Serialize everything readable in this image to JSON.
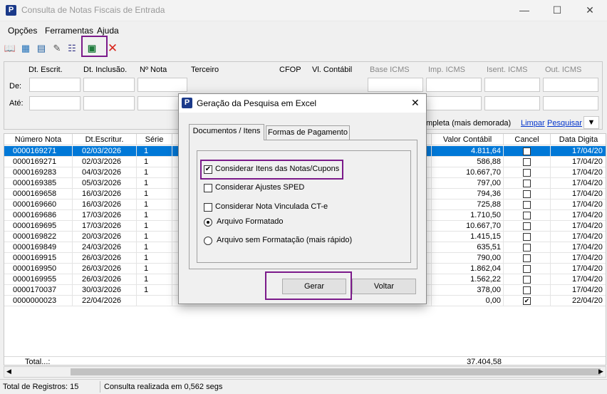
{
  "window": {
    "title": "Consulta de Notas Fiscais de Entrada",
    "logo": "P"
  },
  "menu": [
    "Opções",
    "Ferramentas",
    "Ajuda"
  ],
  "filter": {
    "headers": [
      "Dt. Escrit.",
      "Dt. Inclusão.",
      "Nº Nota",
      "Terceiro",
      "CFOP",
      "Vl. Contábil",
      "Base ICMS",
      "Imp. ICMS",
      "Isent. ICMS",
      "Out. ICMS"
    ],
    "de_label": "De:",
    "ate_label": "Até:",
    "hint": "mpleta (mais demorada)",
    "limpar": "Limpar",
    "pesquisar": "Pesquisar"
  },
  "grid": {
    "headers": [
      "Número Nota",
      "Dt.Escritur.",
      "Série",
      "Valor Contábil",
      "Cancel",
      "Data Digita"
    ],
    "rows": [
      {
        "numero": "0000169271",
        "dt": "02/03/2026",
        "serie": "1",
        "valor": "4.811,64",
        "cancel": false,
        "data": "17/04/20"
      },
      {
        "numero": "0000169271",
        "dt": "02/03/2026",
        "serie": "1",
        "valor": "586,88",
        "cancel": false,
        "data": "17/04/20"
      },
      {
        "numero": "0000169283",
        "dt": "04/03/2026",
        "serie": "1",
        "valor": "10.667,70",
        "cancel": false,
        "data": "17/04/20"
      },
      {
        "numero": "0000169385",
        "dt": "05/03/2026",
        "serie": "1",
        "valor": "797,00",
        "cancel": false,
        "data": "17/04/20"
      },
      {
        "numero": "0000169658",
        "dt": "16/03/2026",
        "serie": "1",
        "valor": "794,36",
        "cancel": false,
        "data": "17/04/20"
      },
      {
        "numero": "0000169660",
        "dt": "16/03/2026",
        "serie": "1",
        "valor": "725,88",
        "cancel": false,
        "data": "17/04/20"
      },
      {
        "numero": "0000169686",
        "dt": "17/03/2026",
        "serie": "1",
        "valor": "1.710,50",
        "cancel": false,
        "data": "17/04/20"
      },
      {
        "numero": "0000169695",
        "dt": "17/03/2026",
        "serie": "1",
        "valor": "10.667,70",
        "cancel": false,
        "data": "17/04/20"
      },
      {
        "numero": "0000169822",
        "dt": "20/03/2026",
        "serie": "1",
        "valor": "1.415,15",
        "cancel": false,
        "data": "17/04/20"
      },
      {
        "numero": "0000169849",
        "dt": "24/03/2026",
        "serie": "1",
        "valor": "635,51",
        "cancel": false,
        "data": "17/04/20"
      },
      {
        "numero": "0000169915",
        "dt": "26/03/2026",
        "serie": "1",
        "valor": "790,00",
        "cancel": false,
        "data": "17/04/20"
      },
      {
        "numero": "0000169950",
        "dt": "26/03/2026",
        "serie": "1",
        "valor": "1.862,04",
        "cancel": false,
        "data": "17/04/20"
      },
      {
        "numero": "0000169955",
        "dt": "26/03/2026",
        "serie": "1",
        "valor": "1.562,22",
        "cancel": false,
        "data": "17/04/20"
      },
      {
        "numero": "0000170037",
        "dt": "30/03/2026",
        "serie": "1",
        "valor": "378,00",
        "cancel": false,
        "data": "17/04/20"
      },
      {
        "numero": "0000000023",
        "dt": "22/04/2026",
        "serie": "",
        "valor": "0,00",
        "cancel": true,
        "data": "22/04/20"
      }
    ],
    "total_label": "Total...:",
    "total_value": "37.404,58"
  },
  "status": {
    "registros": "Total de Registros: 15",
    "tempo": "Consulta realizada em 0,562 segs"
  },
  "dialog": {
    "title": "Geração da Pesquisa em Excel",
    "logo": "P",
    "tabs": [
      "Documentos / Itens",
      "Formas de Pagamento"
    ],
    "options": [
      {
        "label": "Considerar Itens das Notas/Cupons",
        "checked": true
      },
      {
        "label": "Considerar Ajustes SPED",
        "checked": false
      },
      {
        "label": "Considerar Nota Vinculada CT-e",
        "checked": false
      }
    ],
    "radios": [
      {
        "label": "Arquivo Formatado",
        "selected": true
      },
      {
        "label": "Arquivo sem Formatação (mais rápido)",
        "selected": false
      }
    ],
    "gerar": "Gerar",
    "voltar": "Voltar"
  },
  "colors": {
    "selection": "#0078d7",
    "highlight": "#7b1a8a",
    "link": "#0033cc"
  }
}
